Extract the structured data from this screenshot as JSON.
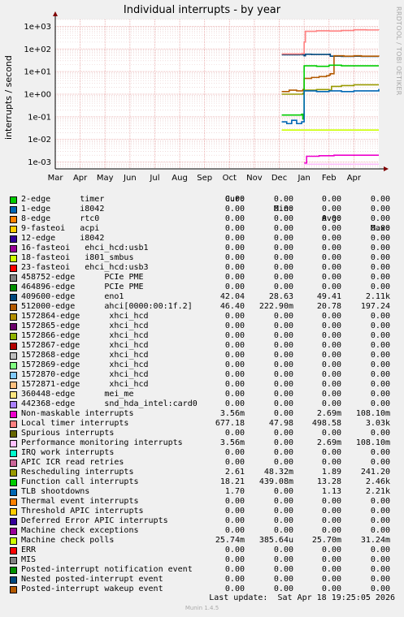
{
  "page": {
    "title": "Individual interrupts - by year",
    "side_label": "RRDTOOL / TOBI OETIKER",
    "footer_label": "Last update:",
    "footer_value": "Sat Apr 18 19:25:05 2026",
    "munin": "Munin 1.4.5"
  },
  "legend_header": {
    "cur": "Cur:",
    "min": "Min:",
    "avg": "Avg:",
    "max": "Max:"
  },
  "colors": {
    "background": "#f0f0f0",
    "plot": "#ffffff",
    "grid_minor": "#e8c8c8",
    "grid_major": "#e6a0a0",
    "axis": "#000000",
    "arrow": "#800000"
  },
  "chart_data": {
    "type": "line",
    "title": "Individual interrupts - by year",
    "xlabel": "",
    "ylabel": "interrupts / second",
    "yscale": "log",
    "ylim": [
      0.0005,
      2000
    ],
    "yticks": [
      0.001,
      0.01,
      0.1,
      1,
      10,
      100,
      1000
    ],
    "ytick_labels": [
      "1e-03",
      "1e-02",
      "1e-01",
      "1e+00",
      "1e+01",
      "1e+02",
      "1e+03"
    ],
    "xlim": [
      0,
      13
    ],
    "xticks": [
      0,
      1,
      2,
      3,
      4,
      5,
      6,
      7,
      8,
      9,
      10,
      11,
      12
    ],
    "xtick_labels": [
      "Mar",
      "Apr",
      "May",
      "Jun",
      "Jul",
      "Aug",
      "Sep",
      "Oct",
      "Nov",
      "Dec",
      "Jan",
      "Feb",
      "Apr"
    ],
    "grid": true,
    "legend_position": "bottom",
    "series": [
      {
        "name": "2-edge      timer",
        "color": "#00cc00",
        "cur": "0.00",
        "min": "0.00",
        "avg": "0.00",
        "max": "0.00",
        "points": []
      },
      {
        "name": "1-edge      i8042",
        "color": "#0066b3",
        "cur": "0.00",
        "min": "0.00",
        "avg": "0.00",
        "max": "0.00",
        "points": []
      },
      {
        "name": "8-edge      rtc0",
        "color": "#ff8000",
        "cur": "0.00",
        "min": "0.00",
        "avg": "0.00",
        "max": "0.00",
        "points": []
      },
      {
        "name": "9-fasteoi   acpi",
        "color": "#ffcc00",
        "cur": "0.00",
        "min": "0.00",
        "avg": "0.00",
        "max": "0.00",
        "points": []
      },
      {
        "name": "12-edge     i8042",
        "color": "#330099",
        "cur": "0.00",
        "min": "0.00",
        "avg": "0.00",
        "max": "0.00",
        "points": []
      },
      {
        "name": "16-fasteoi   ehci_hcd:usb1",
        "color": "#990099",
        "cur": "0.00",
        "min": "0.00",
        "avg": "0.00",
        "max": "0.00",
        "points": []
      },
      {
        "name": "18-fasteoi   i801_smbus",
        "color": "#ccff00",
        "cur": "0.00",
        "min": "0.00",
        "avg": "0.00",
        "max": "0.00",
        "points": []
      },
      {
        "name": "23-fasteoi   ehci_hcd:usb3",
        "color": "#ff0000",
        "cur": "0.00",
        "min": "0.00",
        "avg": "0.00",
        "max": "0.00",
        "points": []
      },
      {
        "name": "458752-edge      PCIe PME",
        "color": "#808080",
        "cur": "0.00",
        "min": "0.00",
        "avg": "0.00",
        "max": "0.00",
        "points": []
      },
      {
        "name": "464896-edge      PCIe PME",
        "color": "#008f00",
        "cur": "0.00",
        "min": "0.00",
        "avg": "0.00",
        "max": "0.00",
        "points": []
      },
      {
        "name": "409600-edge      eno1",
        "color": "#00487d",
        "cur": "42.04",
        "min": "28.63",
        "avg": "49.41",
        "max": "2.11k",
        "points": [
          [
            9.1,
            55
          ],
          [
            9.8,
            56
          ],
          [
            9.95,
            55
          ],
          [
            10.0,
            50
          ],
          [
            10.05,
            58
          ],
          [
            10.3,
            57
          ],
          [
            11.0,
            58
          ],
          [
            11.05,
            48
          ],
          [
            11.5,
            47
          ],
          [
            12.0,
            48
          ],
          [
            12.3,
            47
          ],
          [
            13,
            47
          ]
        ]
      },
      {
        "name": "512000-edge      ahci[0000:00:1f.2]",
        "color": "#b35a00",
        "cur": "46.40",
        "min": "222.90m",
        "avg": "20.78",
        "max": "197.24",
        "points": [
          [
            9.1,
            1.3
          ],
          [
            9.4,
            1.5
          ],
          [
            9.7,
            1.4
          ],
          [
            9.95,
            1.6
          ],
          [
            10.0,
            5
          ],
          [
            10.3,
            5.5
          ],
          [
            10.6,
            6
          ],
          [
            10.9,
            6.5
          ],
          [
            11.0,
            7
          ],
          [
            11.05,
            8
          ],
          [
            11.2,
            50
          ],
          [
            11.6,
            48
          ],
          [
            12.0,
            50
          ],
          [
            12.3,
            48
          ],
          [
            13,
            46
          ]
        ]
      },
      {
        "name": "1572864-edge      xhci_hcd",
        "color": "#b38f00",
        "cur": "0.00",
        "min": "0.00",
        "avg": "0.00",
        "max": "0.00",
        "points": []
      },
      {
        "name": "1572865-edge      xhci_hcd",
        "color": "#6b006b",
        "cur": "0.00",
        "min": "0.00",
        "avg": "0.00",
        "max": "0.00",
        "points": []
      },
      {
        "name": "1572866-edge      xhci_hcd",
        "color": "#8fb300",
        "cur": "0.00",
        "min": "0.00",
        "avg": "0.00",
        "max": "0.00",
        "points": []
      },
      {
        "name": "1572867-edge      xhci_hcd",
        "color": "#b30000",
        "cur": "0.00",
        "min": "0.00",
        "avg": "0.00",
        "max": "0.00",
        "points": []
      },
      {
        "name": "1572868-edge      xhci_hcd",
        "color": "#bebebe",
        "cur": "0.00",
        "min": "0.00",
        "avg": "0.00",
        "max": "0.00",
        "points": []
      },
      {
        "name": "1572869-edge      xhci_hcd",
        "color": "#80ff80",
        "cur": "0.00",
        "min": "0.00",
        "avg": "0.00",
        "max": "0.00",
        "points": []
      },
      {
        "name": "1572870-edge      xhci_hcd",
        "color": "#80c9ff",
        "cur": "0.00",
        "min": "0.00",
        "avg": "0.00",
        "max": "0.00",
        "points": []
      },
      {
        "name": "1572871-edge      xhci_hcd",
        "color": "#ffc080",
        "cur": "0.00",
        "min": "0.00",
        "avg": "0.00",
        "max": "0.00",
        "points": []
      },
      {
        "name": "360448-edge      mei_me",
        "color": "#ffe680",
        "cur": "0.00",
        "min": "0.00",
        "avg": "0.00",
        "max": "0.00",
        "points": []
      },
      {
        "name": "442368-edge      snd_hda_intel:card0",
        "color": "#aa80ff",
        "cur": "0.00",
        "min": "0.00",
        "avg": "0.00",
        "max": "0.00",
        "points": []
      },
      {
        "name": "Non-maskable interrupts",
        "color": "#ee00cc",
        "cur": "3.56m",
        "min": "0.00",
        "avg": "2.69m",
        "max": "108.10m",
        "points": [
          [
            10.0,
            0.0009
          ],
          [
            10.1,
            0.0018
          ],
          [
            10.6,
            0.0019
          ],
          [
            11.2,
            0.002
          ],
          [
            12.0,
            0.002
          ],
          [
            13,
            0.002
          ]
        ]
      },
      {
        "name": "Local timer interrupts",
        "color": "#ff8080",
        "cur": "677.18",
        "min": "47.98",
        "avg": "498.58",
        "max": "3.03k",
        "points": [
          [
            9.1,
            60
          ],
          [
            9.9,
            62
          ],
          [
            10.0,
            200
          ],
          [
            10.05,
            600
          ],
          [
            10.5,
            630
          ],
          [
            11.0,
            620
          ],
          [
            11.5,
            650
          ],
          [
            12.0,
            700
          ],
          [
            12.5,
            690
          ],
          [
            13,
            680
          ]
        ]
      },
      {
        "name": "Spurious interrupts",
        "color": "#666600",
        "cur": "0.00",
        "min": "0.00",
        "avg": "0.00",
        "max": "0.00",
        "points": []
      },
      {
        "name": "Performance monitoring interrupts",
        "color": "#ffbfff",
        "cur": "3.56m",
        "min": "0.00",
        "avg": "2.69m",
        "max": "108.10m",
        "points": [
          [
            10.0,
            0.0008
          ],
          [
            13,
            0.0008
          ]
        ]
      },
      {
        "name": "IRQ work interrupts",
        "color": "#00ffcc",
        "cur": "0.00",
        "min": "0.00",
        "avg": "0.00",
        "max": "0.00",
        "points": []
      },
      {
        "name": "APIC ICR read retries",
        "color": "#cc6699",
        "cur": "0.00",
        "min": "0.00",
        "avg": "0.00",
        "max": "0.00",
        "points": []
      },
      {
        "name": "Rescheduling interrupts",
        "color": "#999900",
        "cur": "2.61",
        "min": "48.32m",
        "avg": "1.89",
        "max": "241.20",
        "points": [
          [
            9.1,
            1.0
          ],
          [
            9.95,
            1.1
          ],
          [
            10.0,
            1.5
          ],
          [
            10.5,
            1.6
          ],
          [
            11.0,
            1.5
          ],
          [
            11.1,
            2.2
          ],
          [
            11.5,
            2.4
          ],
          [
            12.0,
            2.6
          ],
          [
            13,
            2.6
          ]
        ]
      },
      {
        "name": "Function call interrupts",
        "color": "#00cc00",
        "cur": "18.21",
        "min": "439.08m",
        "avg": "13.28",
        "max": "2.46k",
        "points": [
          [
            9.1,
            0.12
          ],
          [
            9.9,
            0.13
          ],
          [
            9.95,
            0.08
          ],
          [
            10.0,
            18
          ],
          [
            10.5,
            17
          ],
          [
            11.0,
            19
          ],
          [
            11.5,
            18
          ],
          [
            12.0,
            18
          ],
          [
            13,
            18
          ]
        ]
      },
      {
        "name": "TLB shootdowns",
        "color": "#0066b3",
        "cur": "1.70",
        "min": "0.00",
        "avg": "1.13",
        "max": "2.21k",
        "points": [
          [
            9.1,
            0.06
          ],
          [
            9.3,
            0.05
          ],
          [
            9.5,
            0.07
          ],
          [
            9.7,
            0.05
          ],
          [
            9.9,
            0.06
          ],
          [
            10.0,
            1.4
          ],
          [
            10.5,
            1.3
          ],
          [
            11.0,
            1.4
          ],
          [
            11.5,
            1.3
          ],
          [
            12.0,
            1.4
          ],
          [
            12.8,
            1.4
          ],
          [
            13,
            1.7
          ]
        ]
      },
      {
        "name": "Thermal event interrupts",
        "color": "#ff8000",
        "cur": "0.00",
        "min": "0.00",
        "avg": "0.00",
        "max": "0.00",
        "points": []
      },
      {
        "name": "Threshold APIC interrupts",
        "color": "#ffcc00",
        "cur": "0.00",
        "min": "0.00",
        "avg": "0.00",
        "max": "0.00",
        "points": []
      },
      {
        "name": "Deferred Error APIC interrupts",
        "color": "#330099",
        "cur": "0.00",
        "min": "0.00",
        "avg": "0.00",
        "max": "0.00",
        "points": []
      },
      {
        "name": "Machine check exceptions",
        "color": "#990099",
        "cur": "0.00",
        "min": "0.00",
        "avg": "0.00",
        "max": "0.00",
        "points": []
      },
      {
        "name": "Machine check polls",
        "color": "#ccff00",
        "cur": "25.74m",
        "min": "385.64u",
        "avg": "25.70m",
        "max": "31.24m",
        "points": [
          [
            9.1,
            0.026
          ],
          [
            13,
            0.026
          ]
        ]
      },
      {
        "name": "ERR",
        "color": "#ff0000",
        "cur": "0.00",
        "min": "0.00",
        "avg": "0.00",
        "max": "0.00",
        "points": []
      },
      {
        "name": "MIS",
        "color": "#808080",
        "cur": "0.00",
        "min": "0.00",
        "avg": "0.00",
        "max": "0.00",
        "points": []
      },
      {
        "name": "Posted-interrupt notification event",
        "color": "#008f00",
        "cur": "0.00",
        "min": "0.00",
        "avg": "0.00",
        "max": "0.00",
        "points": []
      },
      {
        "name": "Nested posted-interrupt event",
        "color": "#00487d",
        "cur": "0.00",
        "min": "0.00",
        "avg": "0.00",
        "max": "0.00",
        "points": []
      },
      {
        "name": "Posted-interrupt wakeup event",
        "color": "#b35a00",
        "cur": "0.00",
        "min": "0.00",
        "avg": "0.00",
        "max": "0.00",
        "points": []
      }
    ]
  }
}
